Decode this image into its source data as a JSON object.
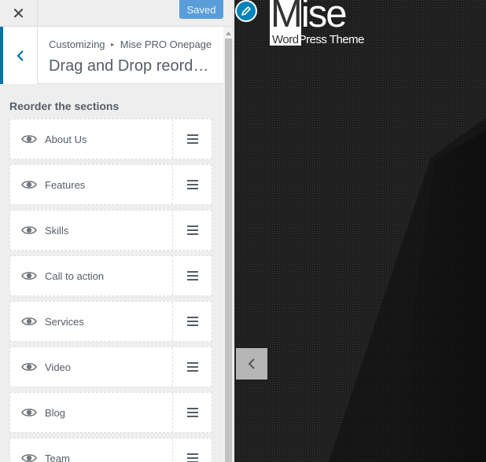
{
  "header": {
    "close_icon": "close-icon",
    "close_glyph": "✕",
    "save_label": "Saved"
  },
  "section": {
    "breadcrumb": [
      "Customizing",
      "Mise PRO Onepage"
    ],
    "breadcrumb_separator": "▸",
    "title": "Drag and Drop reorder…",
    "back_icon": "chevron-left-icon"
  },
  "control": {
    "label": "Reorder the sections",
    "items": [
      {
        "label": "About Us",
        "icon": "eye-icon",
        "handle_icon": "drag-handle-icon"
      },
      {
        "label": "Features",
        "icon": "eye-icon",
        "handle_icon": "drag-handle-icon"
      },
      {
        "label": "Skills",
        "icon": "eye-icon",
        "handle_icon": "drag-handle-icon"
      },
      {
        "label": "Call to action",
        "icon": "eye-icon",
        "handle_icon": "drag-handle-icon"
      },
      {
        "label": "Services",
        "icon": "eye-icon",
        "handle_icon": "drag-handle-icon"
      },
      {
        "label": "Video",
        "icon": "eye-icon",
        "handle_icon": "drag-handle-icon"
      },
      {
        "label": "Blog",
        "icon": "eye-icon",
        "handle_icon": "drag-handle-icon"
      },
      {
        "label": "Team",
        "icon": "eye-icon",
        "handle_icon": "drag-handle-icon"
      }
    ]
  },
  "preview": {
    "logo_main_first": "M",
    "logo_main_rest": "ise",
    "logo_sub_first": "Word",
    "logo_sub_rest": "Press Theme",
    "edit_icon": "pencil-icon",
    "collapse_icon": "chevron-left-icon"
  },
  "colors": {
    "accent": "#0073aa",
    "saved_button": "#5b9dd9",
    "edit_shortcut": "#0085ba",
    "preview_background": "#1c1c1c",
    "sidebar_background": "#eeeeee"
  }
}
